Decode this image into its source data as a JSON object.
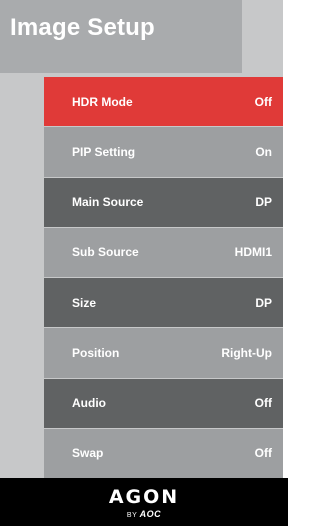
{
  "page": {
    "title": "Image Setup"
  },
  "menu": {
    "items": [
      {
        "label": "HDR Mode",
        "value": "Off",
        "state": "selected"
      },
      {
        "label": "PIP Setting",
        "value": "On",
        "state": "alt"
      },
      {
        "label": "Main Source",
        "value": "DP",
        "state": "normal"
      },
      {
        "label": "Sub Source",
        "value": "HDMI1",
        "state": "alt"
      },
      {
        "label": "Size",
        "value": "DP",
        "state": "normal"
      },
      {
        "label": "Position",
        "value": "Right-Up",
        "state": "alt"
      },
      {
        "label": "Audio",
        "value": "Off",
        "state": "normal"
      },
      {
        "label": "Swap",
        "value": "Off",
        "state": "alt"
      }
    ]
  },
  "footer": {
    "logo_text": "AGON",
    "by_text": "BY",
    "brand_text": "AOC"
  },
  "colors": {
    "selected": "#e03a38",
    "dark_item": "#606263",
    "light_item": "#9d9fa1",
    "panel": "#c7c8c9",
    "title_block": "#a9abad",
    "footer": "#000000"
  }
}
